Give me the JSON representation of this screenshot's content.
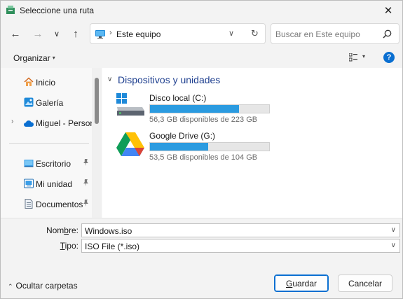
{
  "window": {
    "title": "Seleccione una ruta",
    "close_glyph": "✕"
  },
  "nav": {
    "back_glyph": "←",
    "forward_glyph": "→",
    "recent_glyph": "∨",
    "up_glyph": "↑",
    "address": {
      "separator": "›",
      "location": "Este equipo",
      "dropdown_glyph": "∨",
      "refresh_glyph": "↻"
    },
    "search": {
      "placeholder": "Buscar en Este equipo"
    }
  },
  "commandbar": {
    "organize_label": "Organizar",
    "organize_caret": "▾",
    "view_caret": "▾",
    "help_glyph": "?"
  },
  "sidebar": {
    "items": [
      {
        "label": "Inicio",
        "icon": "home-icon"
      },
      {
        "label": "Galería",
        "icon": "gallery-icon"
      },
      {
        "label": "Miguel - Personal",
        "icon": "onedrive-cloud-icon",
        "chevron": "›"
      },
      {
        "label": "Escritorio",
        "icon": "desktop-icon",
        "pin": "📌"
      },
      {
        "label": "Mi unidad",
        "icon": "drive-folder-icon",
        "pin": "📌"
      },
      {
        "label": "Documentos",
        "icon": "documents-icon",
        "pin": "📌"
      }
    ]
  },
  "main": {
    "group_chevron": "∨",
    "group_title": "Dispositivos y unidades",
    "drives": [
      {
        "name": "Disco local (C:)",
        "free_text": "56,3 GB disponibles de 223 GB",
        "used_fraction": 0.748,
        "icon": "local-disk-icon"
      },
      {
        "name": "Google Drive (G:)",
        "free_text": "53,5 GB disponibles de 104 GB",
        "used_fraction": 0.486,
        "icon": "google-drive-icon"
      }
    ]
  },
  "form": {
    "filename_label_pre": "Nom",
    "filename_label_acc": "b",
    "filename_label_post": "re:",
    "filename_value": "Windows.iso",
    "type_label_acc": "T",
    "type_label_post": "ipo:",
    "type_value": "ISO File (*.iso)",
    "dropdown_glyph": "∨"
  },
  "footer": {
    "hide_folders_glyph": "⌃",
    "hide_folders_label": "Ocultar carpetas",
    "save_acc": "G",
    "save_rest": "uardar",
    "cancel_label": "Cancelar"
  },
  "colors": {
    "accent": "#0a6fd1",
    "bar_fill": "#2b9be0",
    "group_title": "#1e3f8f"
  }
}
